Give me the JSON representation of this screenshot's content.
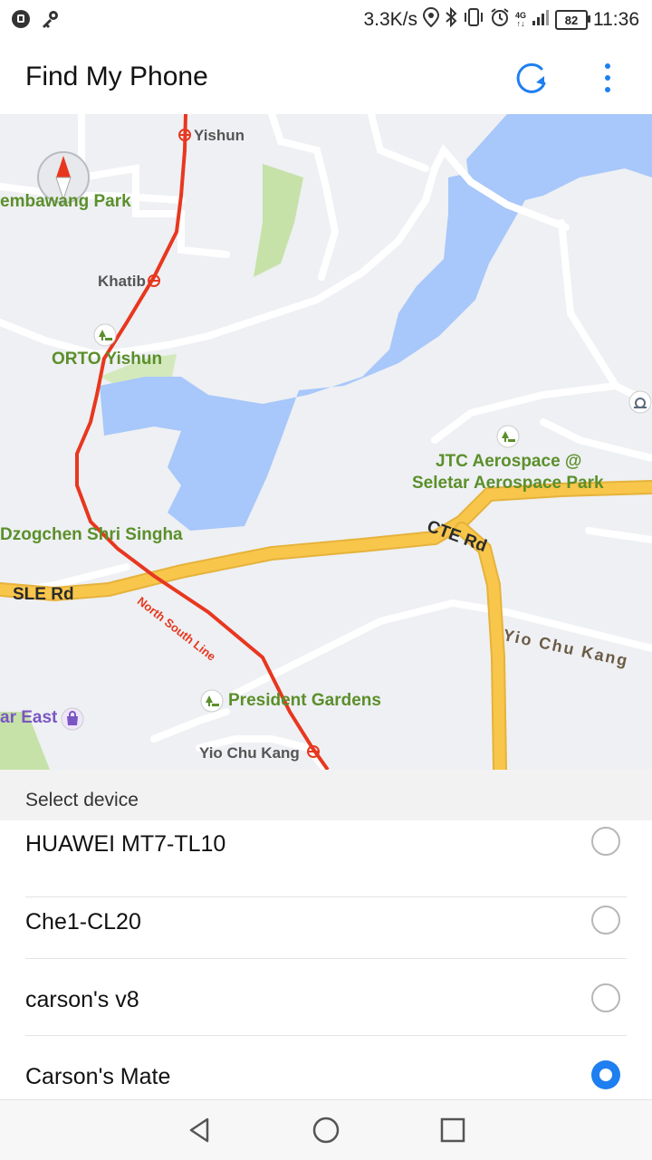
{
  "status_bar": {
    "speed": "3.3K/s",
    "network": "4G",
    "battery": "82",
    "time": "11:36"
  },
  "app_bar": {
    "title": "Find My Phone"
  },
  "map": {
    "labels": {
      "yishun": "Yishun",
      "sembawang_park": "embawang Park",
      "khatib": "Khatib",
      "orto_yishun": "ORTO Yishun",
      "jtc_line1": "JTC Aerospace @",
      "jtc_line2": "Seletar Aerospace Park",
      "dzogchen": "Dzogchen Shri Singha",
      "cte_rd": "CTE Rd",
      "sle_rd": "SLE Rd",
      "north_south_line": "North South Line",
      "yio_chu_kang_road": "Yio Chu Kang",
      "president_gardens": "President Gardens",
      "east": "ar East",
      "yio_chu_kang_station": "Yio Chu Kang"
    }
  },
  "devices": {
    "header": "Select device",
    "items": [
      {
        "label": "HUAWEI MT7-TL10",
        "selected": false
      },
      {
        "label": "Che1-CL20",
        "selected": false
      },
      {
        "label": "carson's v8",
        "selected": false
      },
      {
        "label": "Carson's Mate",
        "selected": true
      }
    ]
  },
  "colors": {
    "accent": "#1e7ff0",
    "water": "#a8c7fa",
    "highway": "#f8c64b",
    "mrt_line": "#e8371f",
    "park": "#c6e2a8"
  }
}
